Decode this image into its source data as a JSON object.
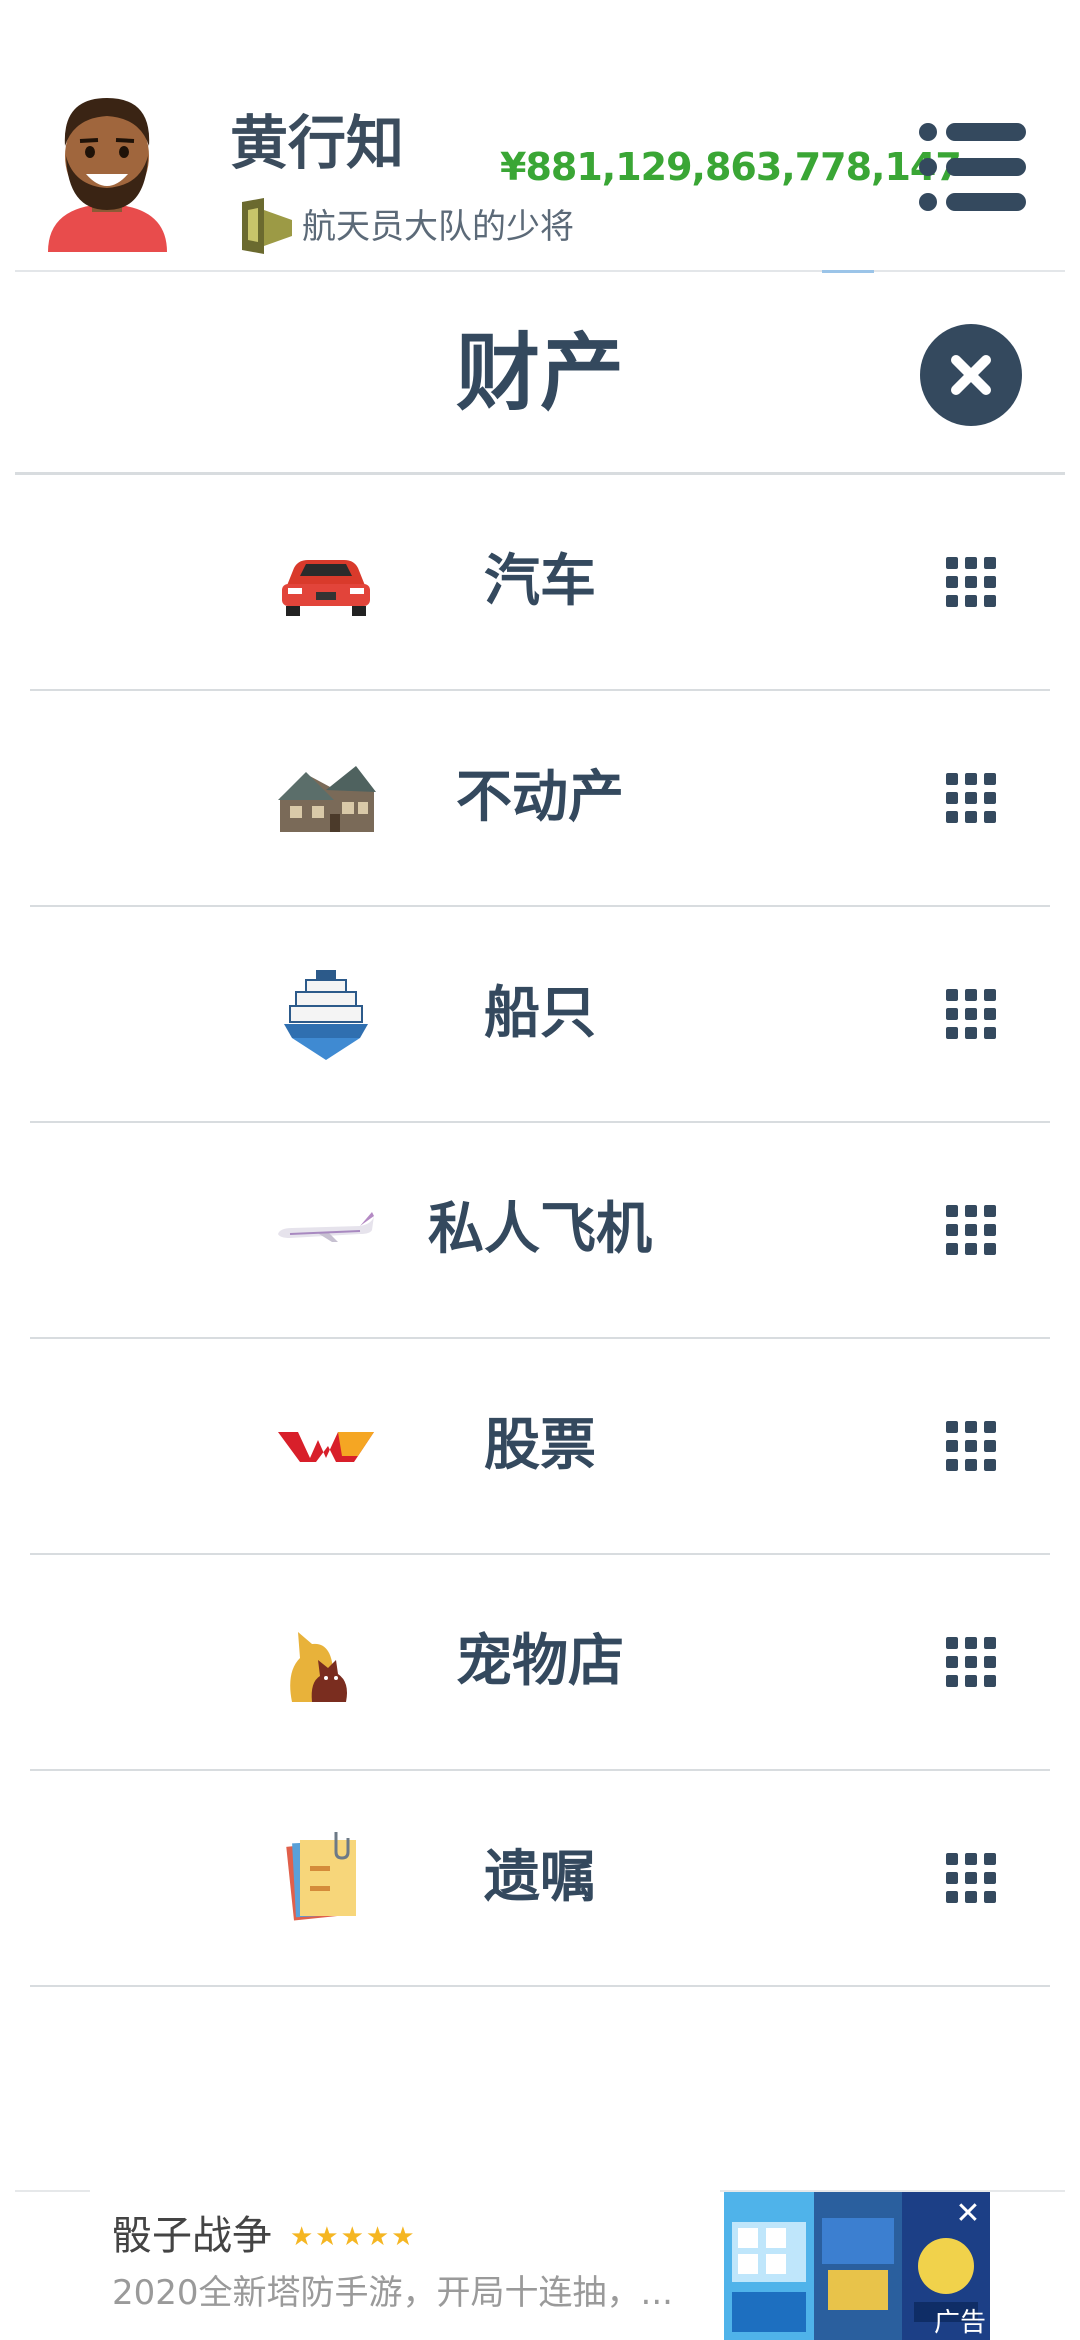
{
  "header": {
    "player_name": "黄行知",
    "rank_title": "航天员大队的少将",
    "balance": "¥881,129,863,778,147"
  },
  "page": {
    "title": "财产"
  },
  "assets": [
    {
      "label": "汽车",
      "icon": "car-icon"
    },
    {
      "label": "不动产",
      "icon": "house-icon"
    },
    {
      "label": "船只",
      "icon": "ship-icon"
    },
    {
      "label": "私人飞机",
      "icon": "airplane-icon"
    },
    {
      "label": "股票",
      "icon": "stocks-logo-icon"
    },
    {
      "label": "宠物店",
      "icon": "pets-icon"
    },
    {
      "label": "遗嘱",
      "icon": "will-note-icon"
    }
  ],
  "ad": {
    "title": "骰子战争",
    "stars": "★★★★★",
    "description": "2020全新塔防手游，开局十连抽，...",
    "badge": "广告",
    "close_glyph": "✕"
  },
  "colors": {
    "primary": "#34495e",
    "balance": "#3aa635",
    "divider": "#d8dcdf"
  }
}
